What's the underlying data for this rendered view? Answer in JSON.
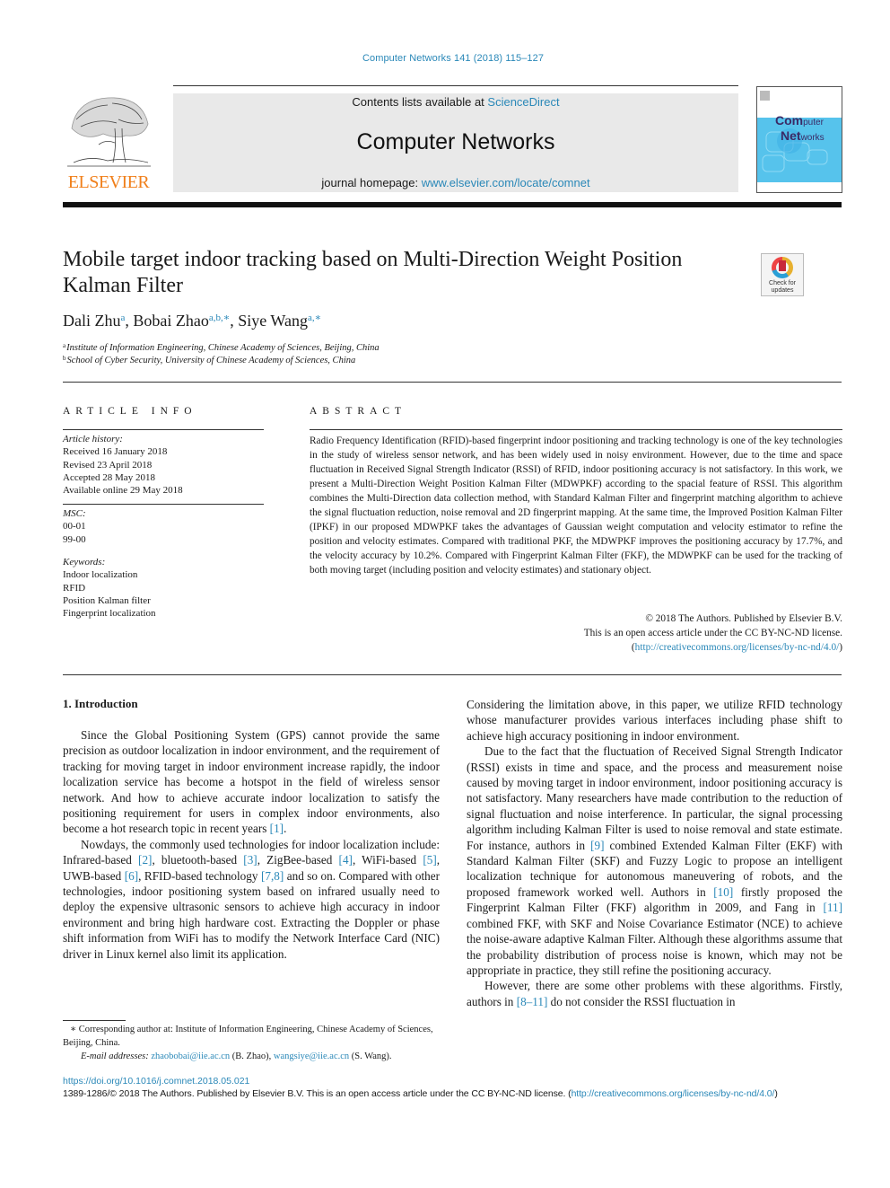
{
  "header": {
    "journal_ref": "Computer Networks 141 (2018) 115–127",
    "contents_prefix": "Contents lists available at ",
    "contents_link": "ScienceDirect",
    "journal_title": "Computer Networks",
    "homepage_prefix": "journal homepage: ",
    "homepage_link": "www.elsevier.com/locate/comnet",
    "publisher_logo": "ELSEVIER",
    "cover_title_line1": "Com",
    "cover_title_line1_small": "puter",
    "cover_title_line2": "Net",
    "cover_title_line2_small": "works",
    "colors": {
      "link": "#2a88b8",
      "elsevier_orange": "#f07f1a",
      "banner_bg": "#e9e9e9",
      "cover_band": "#56c3ec"
    }
  },
  "article": {
    "title": "Mobile target indoor tracking based on Multi-Direction Weight Position Kalman Filter",
    "check_updates_line1": "Check for",
    "check_updates_line2": "updates",
    "authors": [
      {
        "name": "Dali Zhu",
        "sup": "a"
      },
      {
        "name": "Bobai Zhao",
        "sup": "a,b,∗"
      },
      {
        "name": "Siye Wang",
        "sup": "a,∗"
      }
    ],
    "affiliations": [
      {
        "key": "a",
        "text": "Institute of Information Engineering, Chinese Academy of Sciences, Beijing, China"
      },
      {
        "key": "b",
        "text": "School of Cyber Security, University of Chinese Academy of Sciences, China"
      }
    ]
  },
  "article_info": {
    "heading": "ARTICLE INFO",
    "history_label": "Article history:",
    "history": [
      "Received 16 January 2018",
      "Revised 23 April 2018",
      "Accepted 28 May 2018",
      "Available online 29 May 2018"
    ],
    "msc_label": "MSC:",
    "msc": [
      "00-01",
      "99-00"
    ],
    "keywords_label": "Keywords:",
    "keywords": [
      "Indoor localization",
      "RFID",
      "Position Kalman filter",
      "Fingerprint localization"
    ]
  },
  "abstract": {
    "heading": "ABSTRACT",
    "text": "Radio Frequency Identification (RFID)-based fingerprint indoor positioning and tracking technology is one of the key technologies in the study of wireless sensor network, and has been widely used in noisy environment. However, due to the time and space fluctuation in Received Signal Strength Indicator (RSSI) of RFID, indoor positioning accuracy is not satisfactory. In this work, we present a Multi-Direction Weight Position Kalman Filter (MDWPKF) according to the spacial feature of RSSI. This algorithm combines the Multi-Direction data collection method, with Standard Kalman Filter and fingerprint matching algorithm to achieve the signal fluctuation reduction, noise removal and 2D fingerprint mapping. At the same time, the Improved Position Kalman Filter (IPKF) in our proposed MDWPKF takes the advantages of Gaussian weight computation and velocity estimator to refine the position and velocity estimates. Compared with traditional PKF, the MDWPKF improves the positioning accuracy by 17.7%, and the velocity accuracy by 10.2%. Compared with Fingerprint Kalman Filter (FKF), the MDWPKF can be used for the tracking of both moving target (including position and velocity estimates) and stationary object.",
    "copyright_line1": "© 2018 The Authors. Published by Elsevier B.V.",
    "copyright_line2": "This is an open access article under the CC BY-NC-ND license.",
    "license_open": "(",
    "license_link": "http://creativecommons.org/licenses/by-nc-nd/4.0/",
    "license_close": ")"
  },
  "body": {
    "section_heading": "1. Introduction",
    "left": {
      "p1_text": "Since the Global Positioning System (GPS) cannot provide the same precision as outdoor localization in indoor environment, and the requirement of tracking for moving target in indoor environ­ment increase rapidly, the indoor localization service has become a hotspot in the field of wireless sensor network. And how to achieve accurate indoor localization to satisfy the positioning requirement for users in complex indoor environments, also become a hot re­search topic in recent years ",
      "p1_ref": "[1]",
      "p1_end": ".",
      "p2_a": "Nowdays, the commonly used technologies for indoor local­ization include: Infrared-based ",
      "ref2": "[2]",
      "p2_b": ", bluetooth-based ",
      "ref3": "[3]",
      "p2_c": ", ZigBee-based ",
      "ref4": "[4]",
      "p2_d": ", WiFi-based ",
      "ref5": "[5]",
      "p2_e": ", UWB-based ",
      "ref6": "[6]",
      "p2_f": ", RFID-based technology ",
      "ref78": "[7,8]",
      "p2_g": " and so on. Compared with other technologies, indoor posi­tioning system based on infrared usually need to deploy the ex­pensive ultrasonic sensors to achieve high accuracy in indoor envi­ronment and bring high hardware cost. Extracting the Doppler or phase shift information from WiFi has to modify the Network In­terface Card (NIC) driver in Linux kernel also limit its application."
    },
    "right": {
      "p1": "Considering the limitation above, in this paper, we utilize RFID technology whose manufacturer provides various interfaces includ­ing phase shift to achieve high accuracy positioning in indoor en­vironment.",
      "p2_a": "Due to the fact that the fluctuation of Received Signal Strength Indicator (RSSI) exists in time and space, and the process and mea­surement noise caused by moving target in indoor environment, indoor positioning accuracy is not satisfactory. Many researchers have made contribution to the reduction of signal fluctuation and noise interference. In particular, the signal processing algorithm in­cluding Kalman Filter is used to noise removal and state estimate. For instance, authors in ",
      "ref9": "[9]",
      "p2_b": " combined Extended Kalman Filter (EKF) with Standard Kalman Filter (SKF) and Fuzzy Logic to propose an intelligent localization technique for autonomous maneuver­ing of robots, and the proposed framework worked well. Authors in ",
      "ref10": "[10]",
      "p2_c": " firstly proposed the Fingerprint Kalman Filter (FKF) algo­rithm in 2009, and Fang in ",
      "ref11": "[11]",
      "p2_d": " combined FKF, with SKF and Noise Covariance Estimator (NCE) to achieve the noise-aware adaptive Kalman Filter. Although these algorithms assume that the proba­bility distribution of process noise is known, which may not be appropriate in practice, they still refine the positioning accuracy.",
      "p3_a": "However, there are some other problems with these algorithms. Firstly, authors in ",
      "ref811": "[8–11]",
      "p3_b": " do not consider the RSSI fluctuation in"
    }
  },
  "footnote": {
    "corresponding": "∗ Corresponding author at: Institute of Information Engineering, Chinese Academy of Sciences, Beijing, China.",
    "email_label": "E-mail addresses: ",
    "email1": "zhaobobai@iie.ac.cn",
    "email1_name": " (B. Zhao), ",
    "email2": "wangsiye@iie.ac.cn",
    "email2_name": " (S. Wang)."
  },
  "footer": {
    "doi": "https://doi.org/10.1016/j.comnet.2018.05.021",
    "issn_text": "1389-1286/© 2018 The Authors. Published by Elsevier B.V. This is an open access article under the CC BY-NC-ND license. (",
    "issn_link": "http://creativecommons.org/licenses/by-nc-nd/4.0/",
    "issn_close": ")"
  }
}
